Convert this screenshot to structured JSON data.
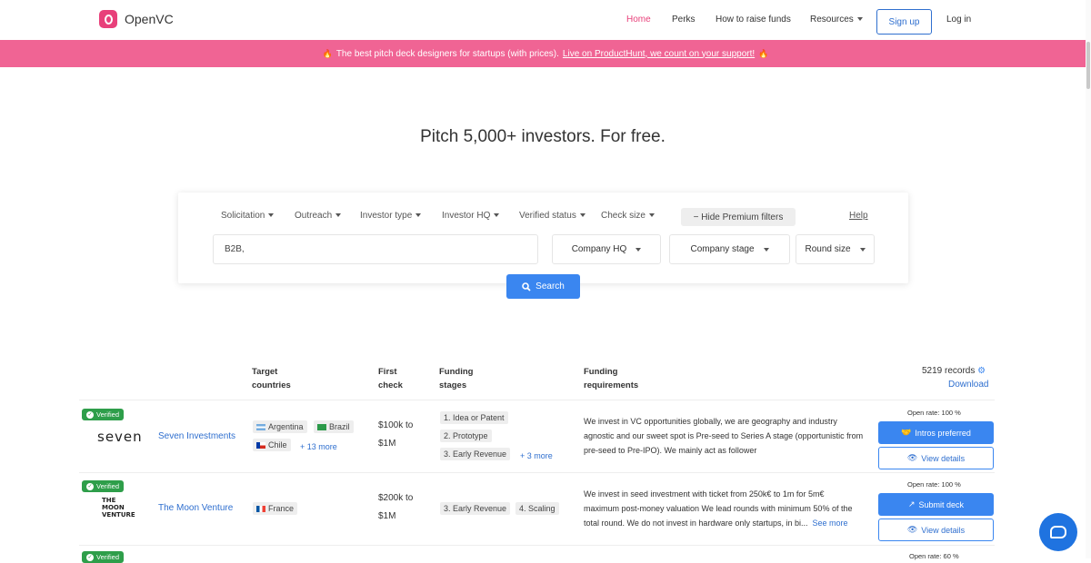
{
  "brand": {
    "name": "OpenVC",
    "accent": "#e8407a"
  },
  "nav": {
    "home": "Home",
    "perks": "Perks",
    "raise": "How to raise funds",
    "resources": "Resources",
    "signup": "Sign up",
    "login": "Log in"
  },
  "banner": {
    "text": "The best pitch deck designers for startups (with prices).",
    "link": "Live on ProductHunt, we count on your support!",
    "color": "#f06494"
  },
  "hero": {
    "title": "Pitch 5,000+ investors. For free."
  },
  "filters": {
    "solicitation": "Solicitation",
    "outreach": "Outreach",
    "investor_type": "Investor type",
    "investor_hq": "Investor HQ",
    "verified_status": "Verified status",
    "check_size": "Check size",
    "hide_premium": "Hide Premium filters",
    "help": "Help",
    "keyword_value": "B2B,",
    "company_hq": "Company HQ",
    "company_stage": "Company stage",
    "round_size": "Round size",
    "search": "Search"
  },
  "table": {
    "headers": {
      "target_countries": [
        "Target",
        "countries"
      ],
      "first_check": [
        "First",
        "check"
      ],
      "funding_stages": [
        "Funding",
        "stages"
      ],
      "funding_requirements": [
        "Funding",
        "requirements"
      ]
    },
    "records": "5219 records",
    "download": "Download",
    "rows": [
      {
        "verified": "Verified",
        "logo_text": "seven",
        "name": "Seven Investments",
        "countries": [
          "Argentina",
          "Brazil",
          "Chile"
        ],
        "countries_more": "+ 13 more",
        "check": [
          "$100k to",
          "$1M"
        ],
        "stages": [
          "1. Idea or Patent",
          "2. Prototype",
          "3. Early Revenue"
        ],
        "stages_more": "+ 3 more",
        "requirements": [
          "We invest in VC opportunities globally, we are geography and industry",
          "agnostic and our sweet spot is Pre-seed to Series A stage (opportunistic from",
          "pre-seed to Pre-IPO). We mainly act as follower"
        ],
        "open_rate": "Open rate: 100 %",
        "primary_action": "Intros preferred",
        "details": "View details"
      },
      {
        "verified": "Verified",
        "logo_text": [
          "THE",
          "MOON",
          "VENTURE"
        ],
        "name": "The Moon Venture",
        "countries": [
          "France"
        ],
        "check": [
          "$200k to",
          "$1M"
        ],
        "stages": [
          "3. Early Revenue",
          "4. Scaling"
        ],
        "requirements": [
          "We invest in seed investment with ticket from 250k€ to 1m for 5m€",
          "maximum post-money valuation We lead rounds with minimum 50% of the",
          "total round. We do not invest in hardware only startups, in bi..."
        ],
        "see_more": "See more",
        "open_rate": "Open rate: 100 %",
        "primary_action": "Submit deck",
        "details": "View details"
      },
      {
        "verified": "Verified",
        "open_rate": "Open rate: 60 %"
      }
    ]
  }
}
